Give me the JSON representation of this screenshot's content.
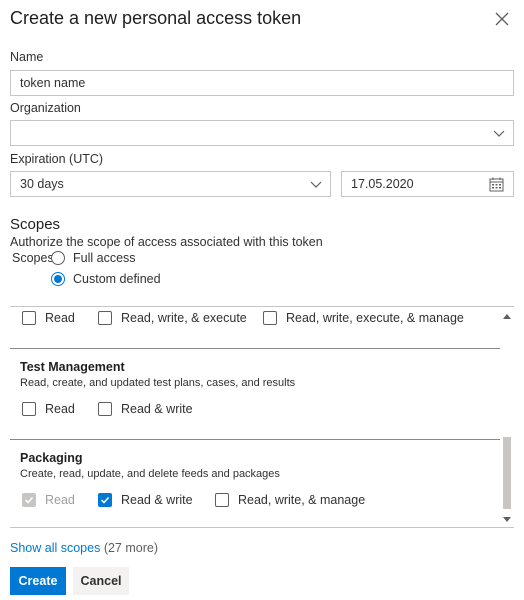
{
  "dialog": {
    "title": "Create a new personal access token",
    "close_icon": "close-icon"
  },
  "name": {
    "label": "Name",
    "value": "token name"
  },
  "organization": {
    "label": "Organization",
    "value": ""
  },
  "expiration": {
    "label": "Expiration (UTC)",
    "preset": "30 days",
    "date": "17.05.2020"
  },
  "scopes": {
    "heading": "Scopes",
    "description": "Authorize the scope of access associated with this token",
    "mini_label": "Scopes",
    "options": [
      {
        "label": "Full access",
        "selected": false
      },
      {
        "label": "Custom defined",
        "selected": true
      }
    ]
  },
  "scope_sections": [
    {
      "title": "",
      "description": "",
      "options": [
        {
          "label": "Read",
          "checked": false,
          "disabled": false
        },
        {
          "label": "Read, write, & execute",
          "checked": false,
          "disabled": false
        },
        {
          "label": "Read, write, execute, & manage",
          "checked": false,
          "disabled": false
        }
      ]
    },
    {
      "title": "Test Management",
      "description": "Read, create, and updated test plans, cases, and results",
      "options": [
        {
          "label": "Read",
          "checked": false,
          "disabled": false
        },
        {
          "label": "Read & write",
          "checked": false,
          "disabled": false
        }
      ]
    },
    {
      "title": "Packaging",
      "description": "Create, read, update, and delete feeds and packages",
      "options": [
        {
          "label": "Read",
          "checked": true,
          "disabled": true
        },
        {
          "label": "Read & write",
          "checked": true,
          "disabled": false
        },
        {
          "label": "Read, write, & manage",
          "checked": false,
          "disabled": false
        }
      ]
    }
  ],
  "footer": {
    "show_all_link": "Show all scopes",
    "show_all_count": "(27 more)",
    "create_label": "Create",
    "cancel_label": "Cancel"
  },
  "colors": {
    "accent": "#0078d4",
    "border": "#c8c6c4",
    "text": "#323130"
  }
}
